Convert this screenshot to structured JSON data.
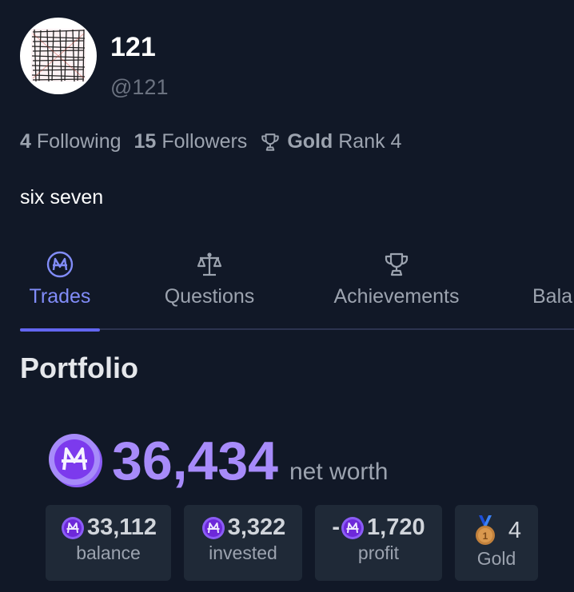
{
  "profile": {
    "display_name": "121",
    "username": "@121",
    "following_count": "4",
    "following_label": "Following",
    "followers_count": "15",
    "followers_label": "Followers",
    "rank_tier": "Gold",
    "rank_text": "Rank 4",
    "bio": "six seven",
    "avatar_icon": "scribble-avatar"
  },
  "tabs": [
    {
      "label": "Trades",
      "icon": "mana-coin-icon",
      "active": true
    },
    {
      "label": "Questions",
      "icon": "scales-icon",
      "active": false
    },
    {
      "label": "Achievements",
      "icon": "trophy-icon",
      "active": false
    },
    {
      "label": "Bala",
      "icon": "",
      "active": false
    }
  ],
  "portfolio": {
    "title": "Portfolio",
    "net_worth_value": "36,434",
    "net_worth_label": "net worth",
    "cards": [
      {
        "value": "33,112",
        "label": "balance",
        "prefix": ""
      },
      {
        "value": "3,322",
        "label": "invested",
        "prefix": ""
      },
      {
        "value": "1,720",
        "label": "profit",
        "prefix": "-"
      },
      {
        "value": "4",
        "label": "Gold",
        "prefix": ""
      }
    ]
  },
  "colors": {
    "background": "#111827",
    "accent": "#818cf8",
    "mana": "#a78bfa",
    "card_bg": "#1f2937"
  }
}
